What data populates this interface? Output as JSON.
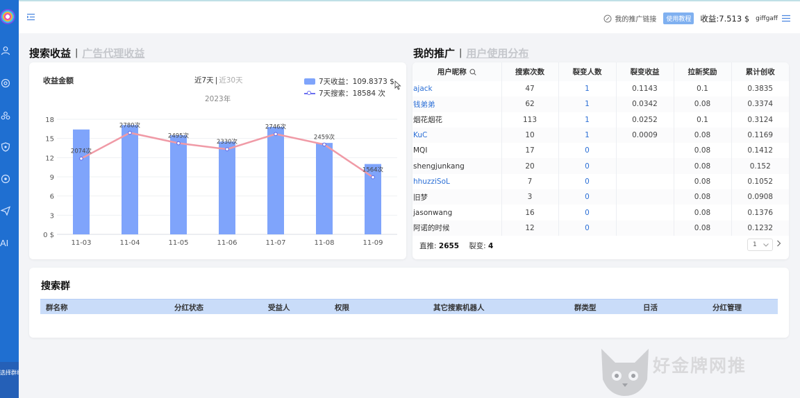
{
  "topbar": {
    "promo_link": "我的推广链接",
    "tutorial": "使用教程",
    "earnings": "收益:7.513 $",
    "username": "giffgaff"
  },
  "sidebar": {
    "ai_label": "AI",
    "select_group": "选择群组 〉"
  },
  "left_section": {
    "title_active": "搜索收益",
    "title_inactive": "广告代理收益"
  },
  "right_section": {
    "title_active": "我的推广",
    "title_inactive": "用户使用分布"
  },
  "chart_card": {
    "title": "收益金额",
    "range_7": "近7天",
    "range_30": "近30天",
    "year": "2023年",
    "legend_bar": "7天收益：109.8373 $",
    "legend_line": "7天搜索：18584 次"
  },
  "chart_data": {
    "type": "bar",
    "categories": [
      "11-03",
      "11-04",
      "11-05",
      "11-06",
      "11-07",
      "11-08",
      "11-09"
    ],
    "series": [
      {
        "name": "7天收益：109.8373 $",
        "type": "bar",
        "values": [
          16.4,
          17.1,
          15.5,
          14.5,
          16.8,
          14.3,
          11.0
        ]
      },
      {
        "name": "7天搜索：18584 次",
        "type": "line",
        "values": [
          2074,
          2780,
          2495,
          2330,
          2746,
          2459,
          1564
        ],
        "labels": [
          "2074次",
          "2780次",
          "2495次",
          "2330次",
          "2746次",
          "2459次",
          "1564次"
        ]
      }
    ],
    "y_ticks": [
      "0 $",
      "3",
      "6",
      "9",
      "12",
      "15",
      "18"
    ],
    "ylim": [
      0,
      18
    ],
    "colors": {
      "bar": "#7fa4fb",
      "line": "#f09aa6",
      "point": "#5b63e8"
    }
  },
  "promo_table": {
    "columns": [
      "用户昵称",
      "搜索次数",
      "裂变人数",
      "裂变收益",
      "拉新奖励",
      "累计创收"
    ],
    "rows": [
      {
        "nick": "ajack",
        "searches": "47",
        "fission": "1",
        "fission_income": "0.1143",
        "reward": "0.1",
        "total": "0.3835",
        "link": true
      },
      {
        "nick": "钱弟弟",
        "searches": "62",
        "fission": "1",
        "fission_income": "0.0342",
        "reward": "0.08",
        "total": "0.3374",
        "link": true
      },
      {
        "nick": "烟花烟花",
        "searches": "113",
        "fission": "1",
        "fission_income": "0.0252",
        "reward": "0.1",
        "total": "0.3124",
        "link": false
      },
      {
        "nick": "KuC",
        "searches": "10",
        "fission": "1",
        "fission_income": "0.0009",
        "reward": "0.08",
        "total": "0.1169",
        "link": true
      },
      {
        "nick": "MQI",
        "searches": "17",
        "fission": "0",
        "fission_income": "",
        "reward": "0.08",
        "total": "0.1412",
        "link": false
      },
      {
        "nick": "shengjunkang",
        "searches": "20",
        "fission": "0",
        "fission_income": "",
        "reward": "0.08",
        "total": "0.152",
        "link": false
      },
      {
        "nick": "hhuzziSoL",
        "searches": "7",
        "fission": "0",
        "fission_income": "",
        "reward": "0.08",
        "total": "0.1052",
        "link": true
      },
      {
        "nick": "旧梦",
        "searches": "3",
        "fission": "0",
        "fission_income": "",
        "reward": "0.08",
        "total": "0.0908",
        "link": false
      },
      {
        "nick": "jasonwang",
        "searches": "16",
        "fission": "0",
        "fission_income": "",
        "reward": "0.08",
        "total": "0.1376",
        "link": false
      },
      {
        "nick": "阿诺的时候",
        "searches": "12",
        "fission": "0",
        "fission_income": "",
        "reward": "0.08",
        "total": "0.1232",
        "link": false
      }
    ],
    "footer_direct_label": "直推:",
    "footer_direct_value": "2655",
    "footer_fission_label": "裂变:",
    "footer_fission_value": "4",
    "page": "1"
  },
  "group_card": {
    "title": "搜索群",
    "columns": [
      "群名称",
      "分红状态",
      "受益人",
      "权限",
      "其它搜索机器人",
      "群类型",
      "日活",
      "分红管理"
    ]
  },
  "watermark": {
    "text": "好金牌网推"
  },
  "colors": {
    "sidebar": "#1f6fd1",
    "accent": "#2b6fd6",
    "table_header": "#c9dcf9"
  }
}
